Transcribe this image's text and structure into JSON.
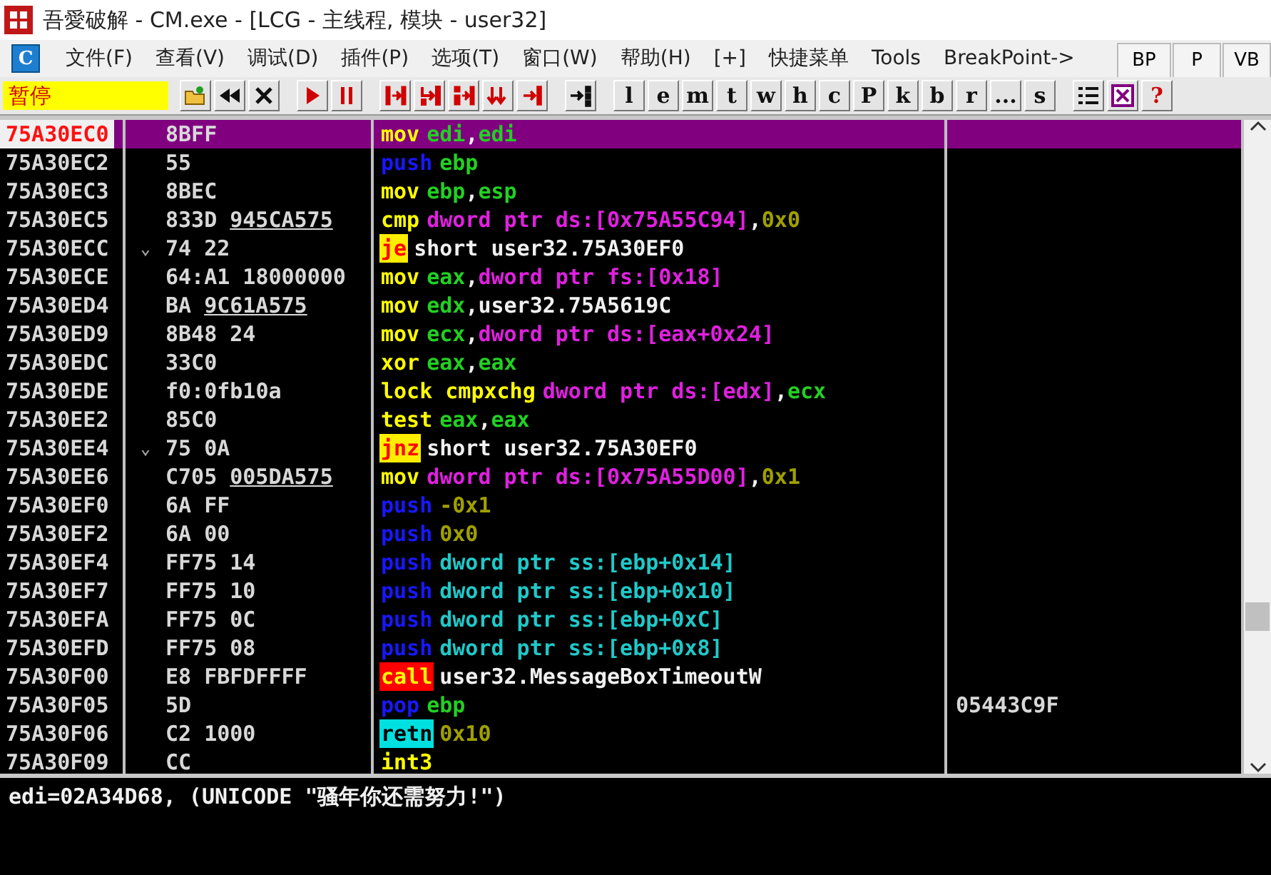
{
  "window": {
    "title": "吾愛破解 - CM.exe - [LCG -  主线程, 模块 - user32]"
  },
  "menu": {
    "app_icon": "C",
    "items": [
      "文件(F)",
      "查看(V)",
      "调试(D)",
      "插件(P)",
      "选项(T)",
      "窗口(W)",
      "帮助(H)",
      "[+]",
      "快捷菜单",
      "Tools",
      "BreakPoint->"
    ],
    "side_buttons": [
      "BP",
      "P",
      "VB"
    ]
  },
  "toolbar": {
    "status": "暂停",
    "letter_buttons": [
      "l",
      "e",
      "m",
      "t",
      "w",
      "h",
      "c",
      "P",
      "k",
      "b",
      "r",
      "...",
      "s"
    ],
    "help": "?"
  },
  "rows": [
    {
      "address": "75A30EC0",
      "selected": true,
      "hex": "8BFF",
      "op": "mov",
      "kind": "plain",
      "args": [
        {
          "kind": "reg",
          "text": "edi"
        },
        {
          "kind": "punct",
          "text": ","
        },
        {
          "kind": "reg",
          "text": "edi"
        }
      ]
    },
    {
      "address": "75A30EC2",
      "selected": false,
      "hex": "55",
      "op": "push",
      "kind": "push",
      "args": [
        {
          "kind": "reg",
          "text": "ebp"
        }
      ]
    },
    {
      "address": "75A30EC3",
      "selected": false,
      "hex": "8BEC",
      "op": "mov",
      "kind": "plain",
      "args": [
        {
          "kind": "reg",
          "text": "ebp"
        },
        {
          "kind": "punct",
          "text": ","
        },
        {
          "kind": "reg",
          "text": "esp"
        }
      ]
    },
    {
      "address": "75A30EC5",
      "selected": false,
      "hex": "833D",
      "hex_ref": "945CA575",
      "op": "cmp",
      "kind": "plain",
      "args": [
        {
          "kind": "mem",
          "text": "dword ptr ds:[0x75A55C94]"
        },
        {
          "kind": "punct",
          "text": ","
        },
        {
          "kind": "imm",
          "text": "0x0"
        }
      ]
    },
    {
      "address": "75A30ECC",
      "selected": false,
      "jump_mark": "⌄",
      "hex": "74 22",
      "op": "je",
      "kind": "jump",
      "args": [
        {
          "kind": "sym",
          "text": "short user32.75A30EF0"
        }
      ]
    },
    {
      "address": "75A30ECE",
      "selected": false,
      "hex": "64:A1 18000000",
      "op": "mov",
      "kind": "plain",
      "args": [
        {
          "kind": "reg",
          "text": "eax"
        },
        {
          "kind": "punct",
          "text": ","
        },
        {
          "kind": "mem",
          "text": "dword ptr fs:[0x18]"
        }
      ]
    },
    {
      "address": "75A30ED4",
      "selected": false,
      "hex": "BA",
      "hex_ref": "9C61A575",
      "op": "mov",
      "kind": "plain",
      "args": [
        {
          "kind": "reg",
          "text": "edx"
        },
        {
          "kind": "punct",
          "text": ","
        },
        {
          "kind": "sym",
          "text": "user32.75A5619C"
        }
      ]
    },
    {
      "address": "75A30ED9",
      "selected": false,
      "hex": "8B48 24",
      "op": "mov",
      "kind": "plain",
      "args": [
        {
          "kind": "reg",
          "text": "ecx"
        },
        {
          "kind": "punct",
          "text": ","
        },
        {
          "kind": "mem",
          "text": "dword ptr ds:[eax+0x24]"
        }
      ]
    },
    {
      "address": "75A30EDC",
      "selected": false,
      "hex": "33C0",
      "op": "xor",
      "kind": "plain",
      "args": [
        {
          "kind": "reg",
          "text": "eax"
        },
        {
          "kind": "punct",
          "text": ","
        },
        {
          "kind": "reg",
          "text": "eax"
        }
      ]
    },
    {
      "address": "75A30EDE",
      "selected": false,
      "hex": "f0:0fb10a",
      "op": "lock cmpxchg",
      "kind": "plain",
      "args": [
        {
          "kind": "mem",
          "text": "dword ptr ds:[edx]"
        },
        {
          "kind": "punct",
          "text": ","
        },
        {
          "kind": "reg",
          "text": "ecx"
        }
      ]
    },
    {
      "address": "75A30EE2",
      "selected": false,
      "hex": "85C0",
      "op": "test",
      "kind": "plain",
      "args": [
        {
          "kind": "reg",
          "text": "eax"
        },
        {
          "kind": "punct",
          "text": ","
        },
        {
          "kind": "reg",
          "text": "eax"
        }
      ]
    },
    {
      "address": "75A30EE4",
      "selected": false,
      "jump_mark": "⌄",
      "hex": "75 0A",
      "op": "jnz",
      "kind": "jump",
      "args": [
        {
          "kind": "sym",
          "text": "short user32.75A30EF0"
        }
      ]
    },
    {
      "address": "75A30EE6",
      "selected": false,
      "hex": "C705",
      "hex_ref": "005DA575",
      "op": "mov",
      "kind": "plain",
      "args": [
        {
          "kind": "mem",
          "text": "dword ptr ds:[0x75A55D00]"
        },
        {
          "kind": "punct",
          "text": ","
        },
        {
          "kind": "imm",
          "text": "0x1"
        }
      ]
    },
    {
      "address": "75A30EF0",
      "selected": false,
      "hex": "6A FF",
      "op": "push",
      "kind": "push",
      "args": [
        {
          "kind": "imm",
          "text": "-0x1"
        }
      ]
    },
    {
      "address": "75A30EF2",
      "selected": false,
      "hex": "6A 00",
      "op": "push",
      "kind": "push",
      "args": [
        {
          "kind": "imm",
          "text": "0x0"
        }
      ]
    },
    {
      "address": "75A30EF4",
      "selected": false,
      "hex": "FF75 14",
      "op": "push",
      "kind": "push",
      "args": [
        {
          "kind": "stack",
          "text": "dword ptr ss:[ebp+0x14]"
        }
      ]
    },
    {
      "address": "75A30EF7",
      "selected": false,
      "hex": "FF75 10",
      "op": "push",
      "kind": "push",
      "args": [
        {
          "kind": "stack",
          "text": "dword ptr ss:[ebp+0x10]"
        }
      ]
    },
    {
      "address": "75A30EFA",
      "selected": false,
      "hex": "FF75 0C",
      "op": "push",
      "kind": "push",
      "args": [
        {
          "kind": "stack",
          "text": "dword ptr ss:[ebp+0xC]"
        }
      ]
    },
    {
      "address": "75A30EFD",
      "selected": false,
      "hex": "FF75 08",
      "op": "push",
      "kind": "push",
      "args": [
        {
          "kind": "stack",
          "text": "dword ptr ss:[ebp+0x8]"
        }
      ]
    },
    {
      "address": "75A30F00",
      "selected": false,
      "hex": "E8 FBFDFFFF",
      "op": "call",
      "kind": "call",
      "args": [
        {
          "kind": "sym",
          "text": "user32.MessageBoxTimeoutW"
        }
      ]
    },
    {
      "address": "75A30F05",
      "selected": false,
      "hex": "5D",
      "op": "pop",
      "kind": "push",
      "args": [
        {
          "kind": "reg",
          "text": "ebp"
        }
      ],
      "comment": "05443C9F"
    },
    {
      "address": "75A30F06",
      "selected": false,
      "hex": "C2 1000",
      "op": "retn",
      "kind": "ret",
      "args": [
        {
          "kind": "imm",
          "text": "0x10"
        }
      ]
    },
    {
      "address": "75A30F09",
      "selected": false,
      "hex": "CC",
      "op": "int3",
      "kind": "plain",
      "args": []
    }
  ],
  "info": "edi=02A34D68, (UNICODE \"骚年你还需努力!\")"
}
